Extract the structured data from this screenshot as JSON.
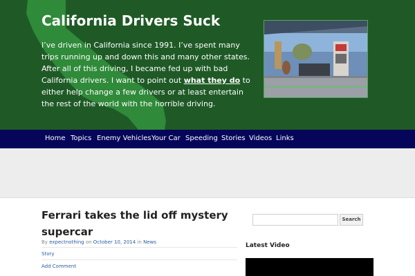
{
  "header": {
    "title": "California Drivers Suck",
    "description_before": "I’ve driven in California since 1991. I’ve spent many trips running up and down this and many other states. After all of this driving, I became fed up with bad California drivers. I want to point out ",
    "description_link": "what they do",
    "description_after": " to either help change a few drivers or at least entertain the rest of the world with the horrible driving."
  },
  "nav": {
    "items": [
      "Home",
      "Topics",
      "Enemy Vehicles",
      "Your Car",
      "Speeding",
      "Stories",
      "Videos",
      "Links"
    ]
  },
  "post": {
    "title": "Ferrari takes the lid off mystery supercar",
    "by_label": "By",
    "author": "expectnothing",
    "on_label": "on",
    "date": "October 10, 2014",
    "in_label": "in",
    "category": "News",
    "tag_link": "Story",
    "comment_link": "Add Comment"
  },
  "sidebar": {
    "search_button": "Search",
    "search_placeholder": "",
    "latest_video_title": "Latest Video"
  },
  "colors": {
    "header_bg": "#1f5a26",
    "state_shape": "#2f8a39",
    "nav_bg": "#05055a",
    "link": "#2a5c9e"
  }
}
